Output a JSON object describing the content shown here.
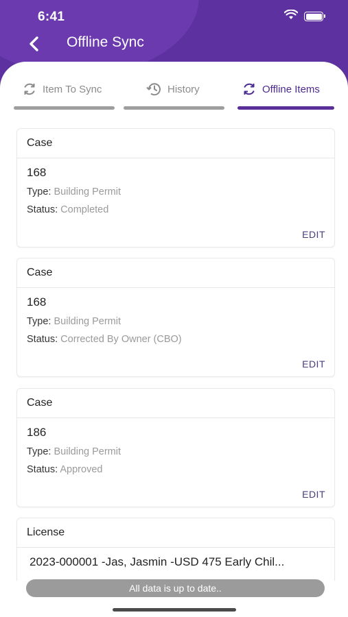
{
  "status_bar": {
    "time": "6:41"
  },
  "header": {
    "title": "Offline Sync",
    "back_icon": "chevron-left-icon"
  },
  "tabs": [
    {
      "label": "Item To Sync",
      "icon": "sync-icon",
      "active": false
    },
    {
      "label": "History",
      "icon": "history-icon",
      "active": false
    },
    {
      "label": "Offline Items",
      "icon": "sync-icon",
      "active": true
    }
  ],
  "cards": [
    {
      "heading": "Case",
      "number": "168",
      "type_label": "Type:",
      "type_value": "Building Permit",
      "status_label": "Status:",
      "status_value": "Completed",
      "action": "EDIT"
    },
    {
      "heading": "Case",
      "number": "168",
      "type_label": "Type:",
      "type_value": "Building Permit",
      "status_label": "Status:",
      "status_value": "Corrected By Owner (CBO)",
      "action": "EDIT"
    },
    {
      "heading": "Case",
      "number": "186",
      "type_label": "Type:",
      "type_value": "Building Permit",
      "status_label": "Status:",
      "status_value": "Approved",
      "action": "EDIT"
    }
  ],
  "license_card": {
    "heading": "License",
    "line": "2023-000001 -Jas, Jasmin -USD 475 Early Chil..."
  },
  "toast": "All data is up to date..",
  "colors": {
    "primary": "#5e31a0",
    "active_tab": "#5a2f98",
    "inactive_tab": "#9e9e9e",
    "value_text": "#9a9a9a"
  }
}
